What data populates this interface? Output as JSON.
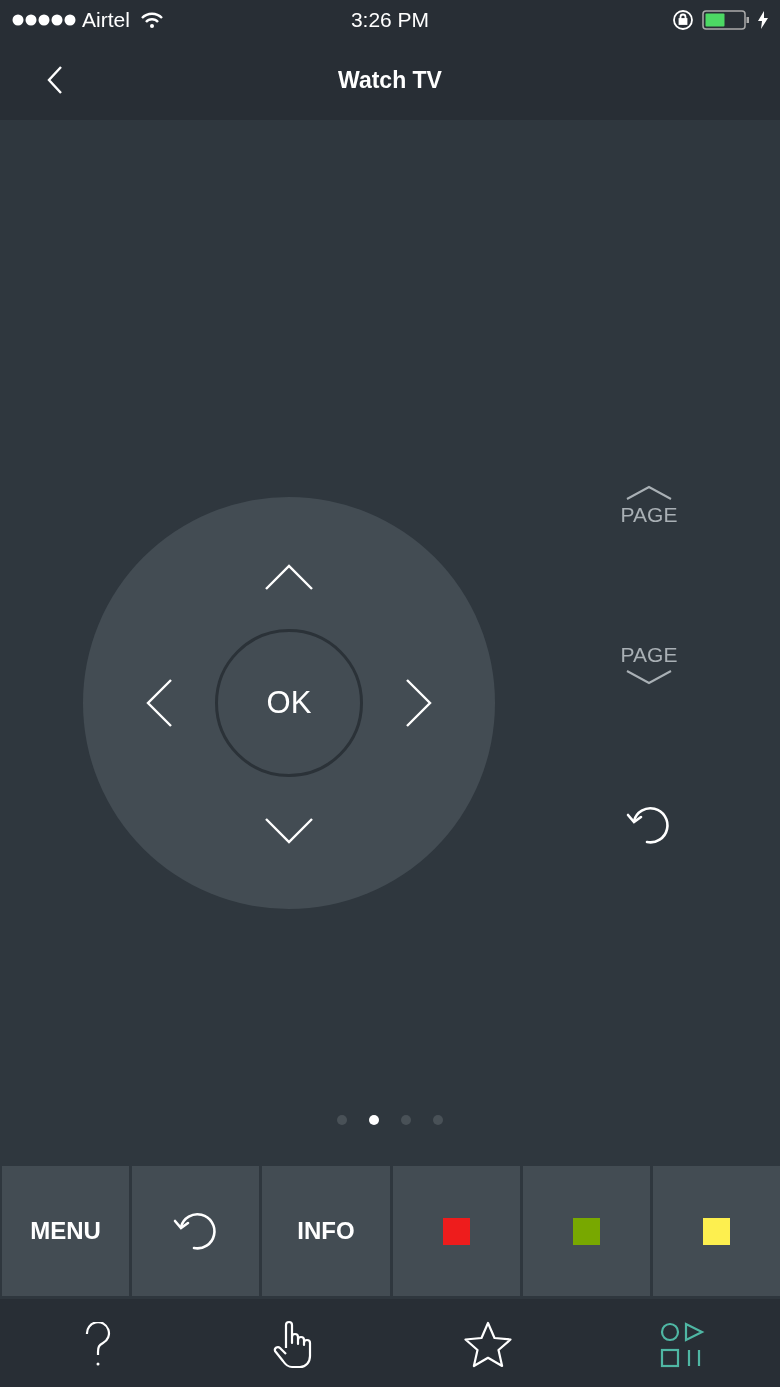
{
  "status_bar": {
    "carrier": "Airtel",
    "time": "3:26 PM"
  },
  "nav": {
    "title": "Watch TV"
  },
  "remote": {
    "ok_label": "OK",
    "page_up": "PAGE",
    "page_down": "PAGE"
  },
  "pager": [
    {
      "selected": false
    },
    {
      "selected": true
    },
    {
      "selected": false
    },
    {
      "selected": false
    }
  ],
  "keys": [
    {
      "kind": "text",
      "label": "MENU"
    },
    {
      "kind": "replay"
    },
    {
      "kind": "text",
      "label": "INFO"
    },
    {
      "kind": "color",
      "color": "#ee1c1c"
    },
    {
      "kind": "color",
      "color": "#78a800"
    },
    {
      "kind": "color",
      "color": "#fdef4f"
    }
  ],
  "tab_bar": [
    {
      "kind": "help",
      "selected": false
    },
    {
      "kind": "touch",
      "selected": false
    },
    {
      "kind": "favorites",
      "selected": false
    },
    {
      "kind": "media",
      "selected": true
    }
  ]
}
